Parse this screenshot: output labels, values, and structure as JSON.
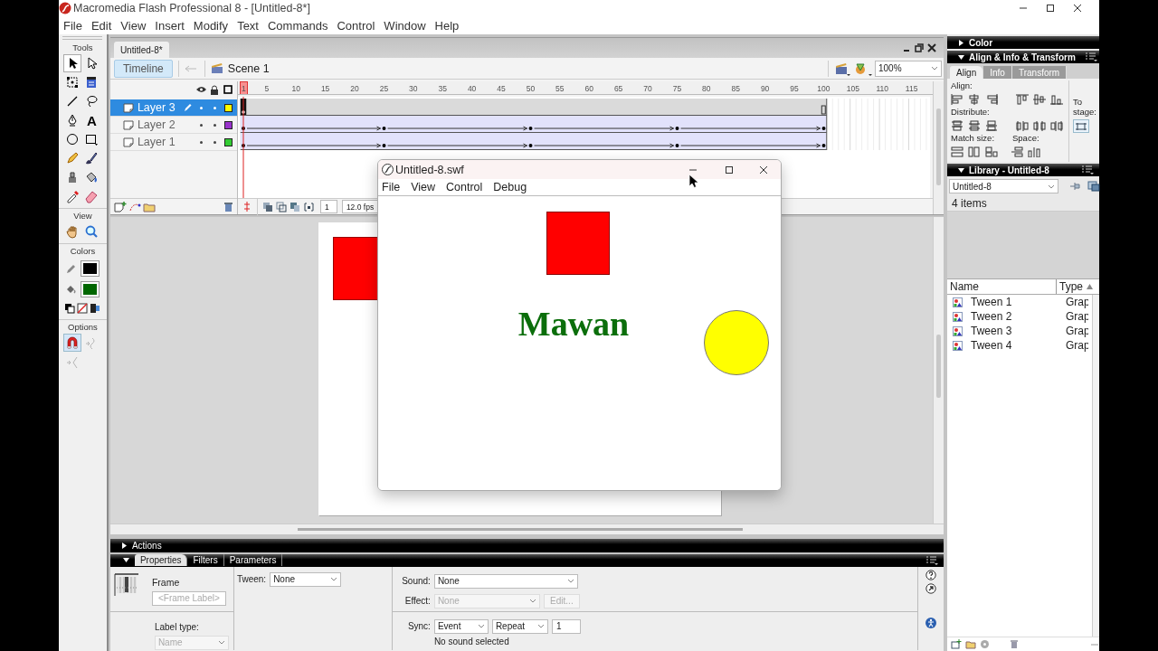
{
  "app": {
    "title": "Macromedia Flash Professional 8 - [Untitled-8*]"
  },
  "menu": [
    "File",
    "Edit",
    "View",
    "Insert",
    "Modify",
    "Text",
    "Commands",
    "Control",
    "Window",
    "Help"
  ],
  "tools": {
    "title": "Tools",
    "items": [
      {
        "kind": "arrow",
        "selected": true
      },
      {
        "kind": "subselect",
        "selected": false
      },
      {
        "kind": "free-transform",
        "selected": false
      },
      {
        "kind": "fill-transform",
        "selected": false
      },
      {
        "kind": "line",
        "selected": false
      },
      {
        "kind": "lasso",
        "selected": false
      },
      {
        "kind": "pen",
        "selected": false
      },
      {
        "kind": "text",
        "glyph": "A",
        "selected": false
      },
      {
        "kind": "oval",
        "selected": false
      },
      {
        "kind": "rectangle",
        "selected": false
      },
      {
        "kind": "pencil",
        "selected": false
      },
      {
        "kind": "brush",
        "selected": false
      },
      {
        "kind": "ink-bottle",
        "selected": false
      },
      {
        "kind": "paint-bucket",
        "selected": false
      },
      {
        "kind": "eyedropper",
        "selected": false
      },
      {
        "kind": "eraser",
        "selected": false
      }
    ],
    "view_title": "View",
    "view_items": [
      {
        "kind": "hand",
        "selected": false
      },
      {
        "kind": "zoom",
        "selected": false
      }
    ],
    "colors_title": "Colors",
    "color_wells": [
      {
        "kind": "stroke",
        "color": "#000000"
      },
      {
        "kind": "fill",
        "color": "#006600"
      }
    ],
    "options_title": "Options",
    "options": [
      {
        "kind": "snap",
        "selected": true,
        "disabled": false
      },
      {
        "kind": "smooth",
        "selected": false,
        "disabled": true
      },
      {
        "kind": "straighten",
        "selected": false,
        "disabled": true
      }
    ]
  },
  "document": {
    "tab": "Untitled-8*",
    "timeline_button": "Timeline",
    "scene": "Scene 1",
    "zoom": "100%",
    "ruler": [
      "1",
      "5",
      "10",
      "15",
      "20",
      "25",
      "30",
      "35",
      "40",
      "45",
      "50",
      "55",
      "60",
      "65",
      "70",
      "75",
      "80",
      "85",
      "90",
      "95",
      "100",
      "105",
      "110",
      "115"
    ],
    "layers": [
      {
        "name": "Layer 3",
        "selected": true,
        "color": "#ffff00",
        "kind": "static"
      },
      {
        "name": "Layer 2",
        "selected": false,
        "color": "#9933cc",
        "kind": "motion-tween"
      },
      {
        "name": "Layer 1",
        "selected": false,
        "color": "#33cc33",
        "kind": "motion-tween"
      }
    ],
    "current_frame": "1",
    "frame_rate": "12.0 fps"
  },
  "player": {
    "title": "Untitled-8.swf",
    "menu": [
      "File",
      "View",
      "Control",
      "Debug"
    ],
    "movie_text": "Mawan"
  },
  "properties": {
    "collapsed_panel": {
      "title": "Actions",
      "expanded": false
    },
    "tabs": [
      {
        "label": "Properties",
        "selected": true
      },
      {
        "label": "Filters",
        "selected": false
      },
      {
        "label": "Parameters",
        "selected": false
      }
    ],
    "type": "Frame",
    "frame_label": {
      "placeholder": "<Frame Label>"
    },
    "label_type": {
      "label": "Label type:",
      "value": "Name",
      "disabled": true
    },
    "tween": {
      "label": "Tween:",
      "value": "None",
      "disabled": false
    },
    "sound": {
      "label": "Sound:",
      "value": "None",
      "disabled": false
    },
    "effect": {
      "label": "Effect:",
      "value": "None",
      "disabled": true
    },
    "edit_button": {
      "label": "Edit...",
      "disabled": true
    },
    "sync": {
      "label": "Sync:",
      "value": "Event",
      "disabled": false
    },
    "repeat": {
      "value": "Repeat",
      "disabled": false
    },
    "repeat_count": {
      "value": "1"
    },
    "status": "No sound selected"
  },
  "panels": {
    "color": {
      "title": "Color",
      "expanded": false
    },
    "align": {
      "title": "Align & Info & Transform",
      "expanded": true,
      "tabs": [
        {
          "label": "Align",
          "selected": true
        },
        {
          "label": "Info",
          "selected": false
        },
        {
          "label": "Transform",
          "selected": false
        }
      ],
      "align_label": "Align:",
      "distribute_label": "Distribute:",
      "match_size_label": "Match size:",
      "space_label": "Space:",
      "to_stage_label": "To stage:"
    },
    "library": {
      "title": "Library - Untitled-8",
      "expanded": true,
      "document": "Untitled-8",
      "count": "4 items",
      "columns": [
        "Name",
        "Type"
      ],
      "items": [
        {
          "name": "Tween 1",
          "type": "Grap"
        },
        {
          "name": "Tween 2",
          "type": "Grap"
        },
        {
          "name": "Tween 3",
          "type": "Grap"
        },
        {
          "name": "Tween 4",
          "type": "Grap"
        }
      ]
    }
  }
}
